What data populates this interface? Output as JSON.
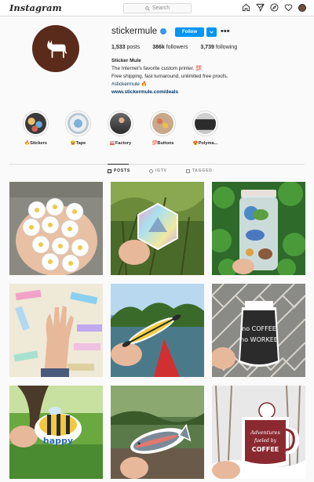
{
  "nav": {
    "logo": "Instagram",
    "search_placeholder": "Search",
    "icons": [
      "home-icon",
      "direct-icon",
      "explore-icon",
      "heart-icon",
      "profile-avatar"
    ]
  },
  "profile": {
    "username": "stickermule",
    "verified": true,
    "follow_label": "Follow",
    "more_label": "•••",
    "stats": {
      "posts": "1,533",
      "posts_label": "posts",
      "followers": "386k",
      "followers_label": "followers",
      "following": "3,739",
      "following_label": "following"
    },
    "bio": {
      "name": "Sticker Mule",
      "line1": "The Internet's favorite custom printer. 💯",
      "line2": "Free shipping, fast turnaround, unlimited free proofs.",
      "hashtag": "#stickermule 🔥",
      "link": "www.stickermule.com/deals"
    }
  },
  "highlights": [
    {
      "label": "🔥Stickers"
    },
    {
      "label": "😆Tape"
    },
    {
      "label": "🏭Factory"
    },
    {
      "label": "💯Buttons"
    },
    {
      "label": "😍Polyma..."
    }
  ],
  "tabs": [
    {
      "label": "POSTS",
      "active": true
    },
    {
      "label": "IGTV",
      "active": false
    },
    {
      "label": "TAGGED",
      "active": false
    }
  ],
  "posts": [
    {
      "name": "flower-stickers-post"
    },
    {
      "name": "holographic-sticker-post"
    },
    {
      "name": "glass-jar-stickers-post"
    },
    {
      "name": "boston-stickers-post"
    },
    {
      "name": "kayak-sticker-post",
      "text": ""
    },
    {
      "name": "coffee-sticker-post",
      "text": "no COFFEE no WORKEE"
    },
    {
      "name": "bee-sticker-post",
      "text": "happy"
    },
    {
      "name": "trout-sticker-post"
    },
    {
      "name": "mug-sticker-post",
      "text": "Adventures fueled by COFFEE"
    }
  ],
  "colors": {
    "brand_blue": "#0095f6",
    "avatar_brown": "#5a2a1a"
  }
}
